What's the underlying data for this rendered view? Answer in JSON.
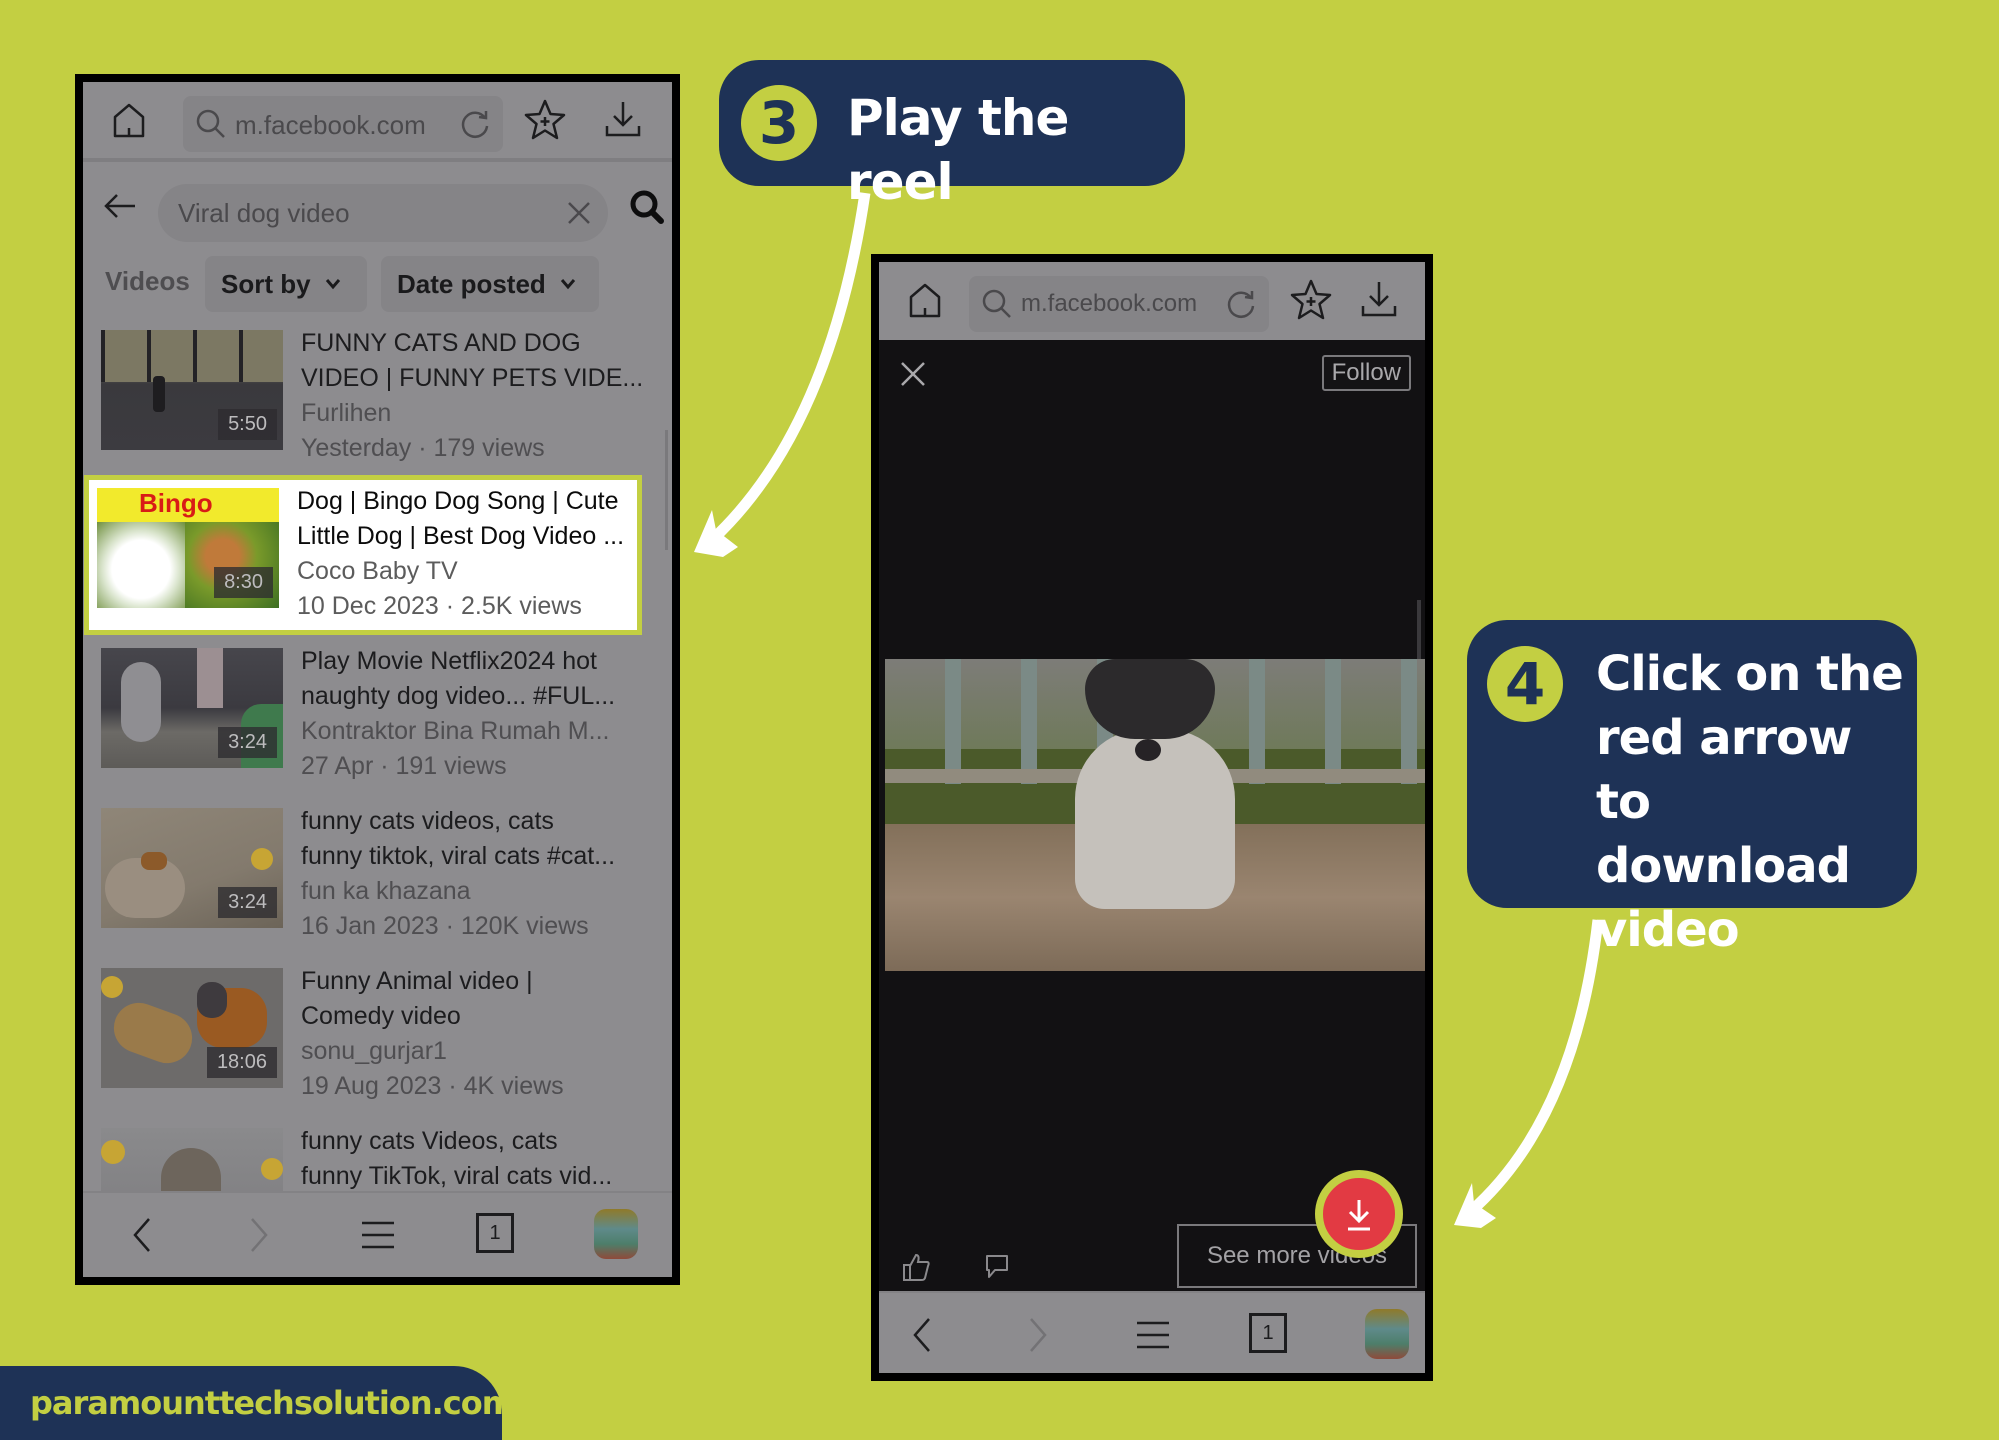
{
  "colors": {
    "background": "#c3cf42",
    "callout_bg": "#1e3256",
    "accent": "#c3cf42",
    "download_button": "#e23a43"
  },
  "callouts": {
    "step3": {
      "number": "3",
      "text": "Play the reel"
    },
    "step4": {
      "number": "4",
      "text": "Click on the red arrow to download video"
    }
  },
  "brand": {
    "text": "paramounttechsolution.com"
  },
  "left_phone": {
    "browser": {
      "url": "m.facebook.com",
      "icons": [
        "home-icon",
        "search-icon",
        "reload-icon",
        "bookmark-star-icon",
        "download-icon"
      ]
    },
    "search": {
      "query": "Viral dog video",
      "back_icon": "back-arrow-icon",
      "clear_icon": "close-icon",
      "search_icon": "search-icon"
    },
    "filters": {
      "label": "Videos",
      "sort_by": "Sort by",
      "date_posted": "Date posted"
    },
    "results": [
      {
        "title_line1": "FUNNY CATS AND DOG",
        "title_line2": "VIDEO | FUNNY PETS VIDE...",
        "channel": "Furlihen",
        "meta": "Yesterday · 179 views",
        "duration": "5:50",
        "highlighted": false
      },
      {
        "title_line1": "Dog | Bingo Dog Song | Cute",
        "title_line2": "Little Dog | Best Dog Video ...",
        "channel": "Coco Baby TV",
        "meta": "10 Dec 2023 · 2.5K views",
        "duration": "8:30",
        "thumb_label": "Bingo",
        "highlighted": true
      },
      {
        "title_line1": "Play Movie Netflix2024  hot",
        "title_line2": "naughty dog video... #FUL...",
        "channel": "Kontraktor Bina Rumah M...",
        "meta": "27 Apr · 191 views",
        "duration": "3:24",
        "highlighted": false
      },
      {
        "title_line1": "funny cats videos, cats",
        "title_line2": "funny tiktok, viral cats #cat...",
        "channel": "fun ka khazana",
        "meta": "16 Jan 2023 · 120K views",
        "duration": "3:24",
        "highlighted": false
      },
      {
        "title_line1": "Funny Animal video |",
        "title_line2": "Comedy video",
        "channel": "sonu_gurjar1",
        "meta": "19 Aug 2023 · 4K views",
        "duration": "18:06",
        "highlighted": false
      },
      {
        "title_line1": "funny cats Videos, cats",
        "title_line2": "funny TikTok, viral cats vid...",
        "channel": "",
        "meta": "",
        "duration": "",
        "highlighted": false
      }
    ],
    "bottom_nav": {
      "tab_count": "1"
    }
  },
  "right_phone": {
    "browser": {
      "url": "m.facebook.com"
    },
    "reel": {
      "follow_label": "Follow",
      "see_more_label": "See more videos"
    },
    "bottom_nav": {
      "tab_count": "1"
    }
  }
}
